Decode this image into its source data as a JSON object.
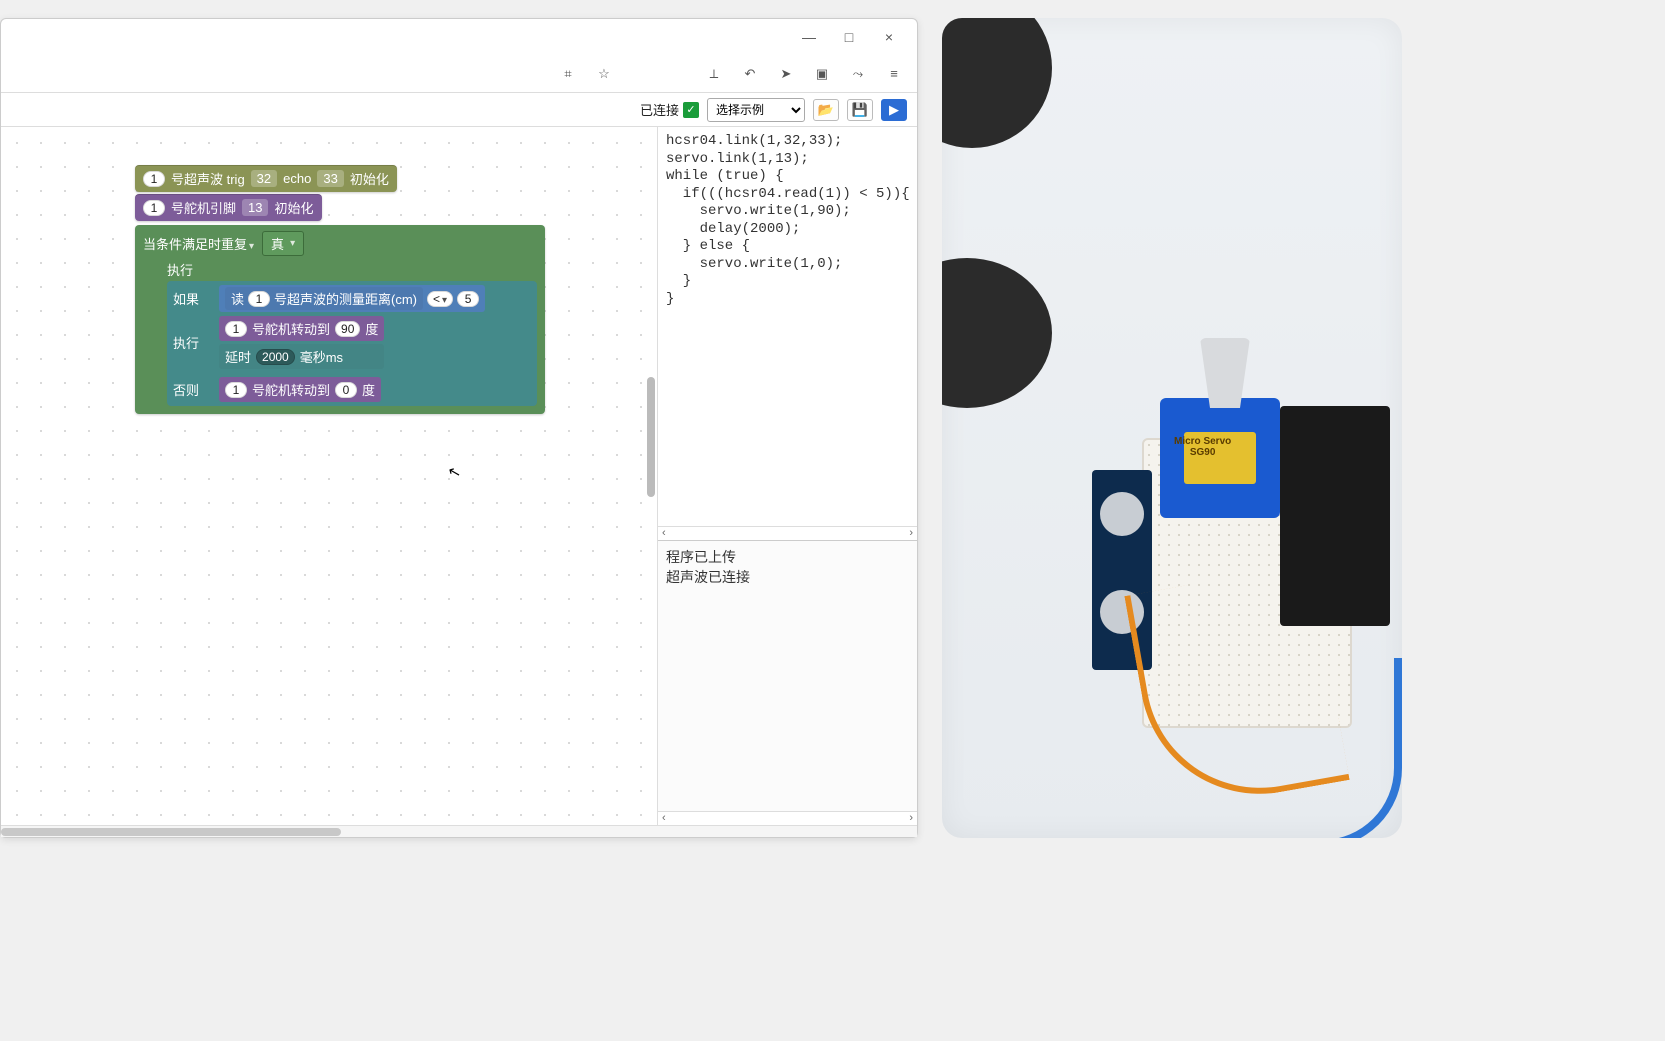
{
  "window": {
    "minimize": "—",
    "maximize": "□",
    "close": "×"
  },
  "browser_icons": {
    "qr": "⌗",
    "star": "☆",
    "crop": "⟂",
    "undo": "↶",
    "send": "➤",
    "ext": "▣",
    "graph": "⤳",
    "menu": "≡"
  },
  "toolbar": {
    "status_label": "已连接",
    "example_select": "选择示例",
    "open": "📂",
    "save": "💾",
    "run": "▶"
  },
  "blocks": {
    "ultra_init": {
      "id": "1",
      "label_a": "号超声波 trig",
      "trig": "32",
      "label_b": "echo",
      "echo": "33",
      "label_c": "初始化"
    },
    "servo_init": {
      "id": "1",
      "label_a": "号舵机引脚",
      "pin": "13",
      "label_b": "初始化"
    },
    "loop_header": "当条件满足时重复",
    "true_label": "真",
    "exec_label": "执行",
    "if_label": "如果",
    "else_label": "否则",
    "read_prefix": "读",
    "read_id": "1",
    "read_label": "号超声波的测量距离(cm)",
    "cmp_op": "<",
    "cmp_val": "5",
    "servo_turn_prefix_id": "1",
    "servo_turn_label": "号舵机转动到",
    "servo_turn_unit": "度",
    "servo_deg_if": "90",
    "servo_deg_else": "0",
    "delay_label": "延时",
    "delay_val": "2000",
    "delay_unit": "毫秒ms"
  },
  "code_text": "hcsr04.link(1,32,33);\nservo.link(1,13);\nwhile (true) {\n  if(((hcsr04.read(1)) < 5)){\n    servo.write(1,90);\n    delay(2000);\n  } else {\n    servo.write(1,0);\n  }\n}",
  "log_text": "程序已上传\n超声波已连接",
  "servo_brand": "Micro Servo",
  "servo_model": "SG90"
}
